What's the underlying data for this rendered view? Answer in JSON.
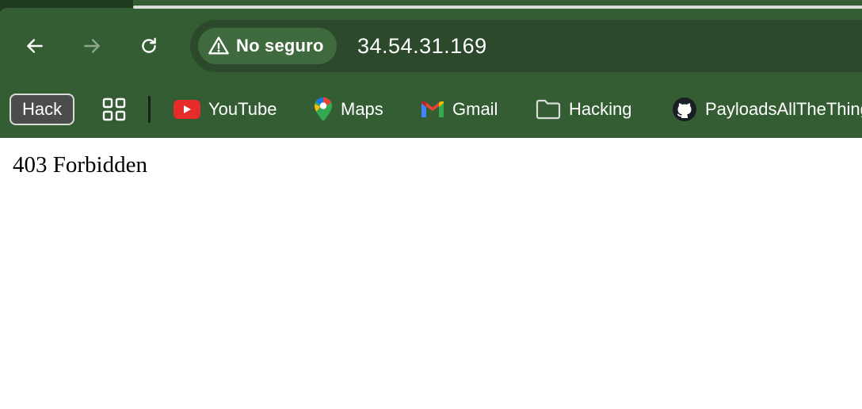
{
  "browser": {
    "nav": {
      "back_icon": "arrow-left-icon",
      "forward_icon": "arrow-right-icon",
      "reload_icon": "reload-icon"
    },
    "omnibox": {
      "security_icon": "warning-triangle-icon",
      "security_label": "No seguro",
      "url": "34.54.31.169"
    },
    "bookmarks": {
      "hack_label": "Hack",
      "apps_icon": "apps-grid-icon",
      "items": [
        {
          "label": "YouTube",
          "icon": "youtube-icon"
        },
        {
          "label": "Maps",
          "icon": "maps-icon"
        },
        {
          "label": "Gmail",
          "icon": "gmail-icon"
        },
        {
          "label": "Hacking",
          "icon": "folder-icon"
        },
        {
          "label": "PayloadsAllTheThings",
          "icon": "github-icon"
        }
      ]
    },
    "colors": {
      "frame": "#345d33",
      "omnibox": "#2c4a2b",
      "chip": "#3f6a3d"
    }
  },
  "page": {
    "body_text": "403 Forbidden"
  }
}
